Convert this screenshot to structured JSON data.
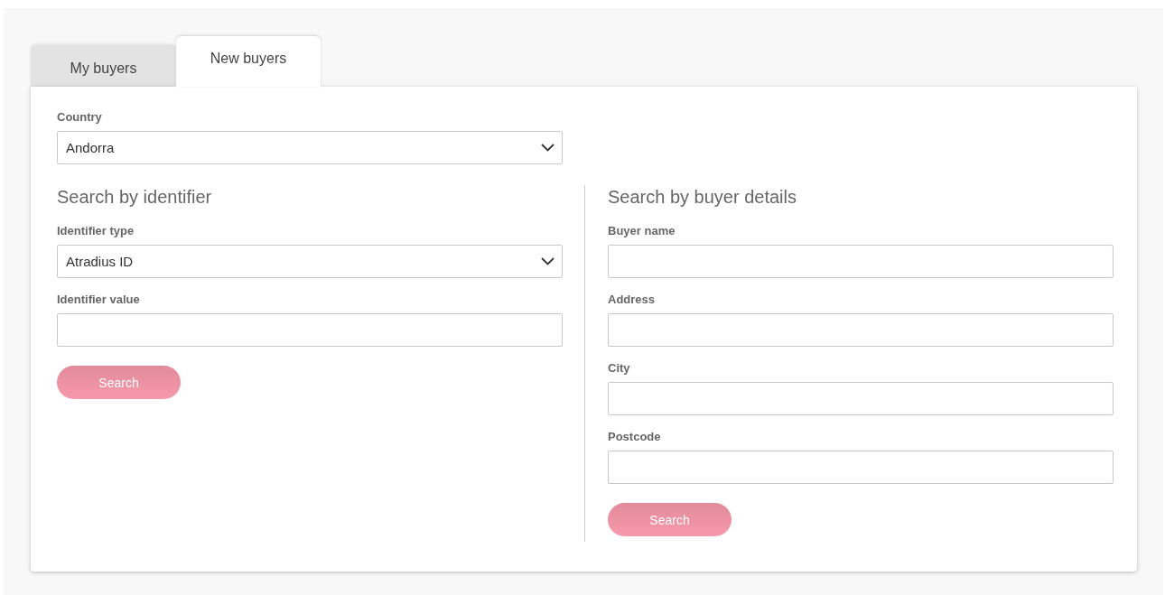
{
  "tabs": [
    {
      "label": "My buyers",
      "selected": false
    },
    {
      "label": "New buyers",
      "selected": true
    }
  ],
  "country": {
    "label": "Country",
    "kind": "select",
    "value": "Andorra"
  },
  "sections": [
    {
      "title": "Search by identifier",
      "fields": [
        {
          "label": "Identifier type",
          "kind": "select",
          "value": "Atradius ID"
        },
        {
          "label": "Identifier value",
          "kind": "text"
        }
      ],
      "button": "Search"
    },
    {
      "title": "Search by buyer details",
      "fields": [
        {
          "label": "Buyer name",
          "kind": "text"
        },
        {
          "label": "Address",
          "kind": "text"
        },
        {
          "label": "City",
          "kind": "text"
        },
        {
          "label": "Postcode",
          "kind": "text"
        }
      ],
      "button": "Search"
    }
  ]
}
